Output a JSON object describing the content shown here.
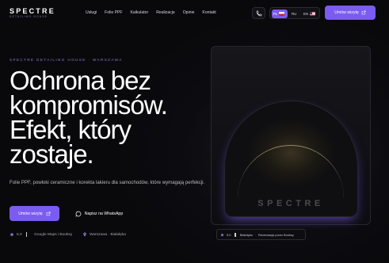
{
  "header": {
    "logo": "SPECTRE",
    "logo_sub": "DETAILING HOUSE",
    "nav": [
      "Usługi",
      "Folie PPF",
      "Kalkulator",
      "Realizacje",
      "Opinie",
      "Kontakt"
    ],
    "languages": [
      {
        "code": "PL",
        "active": true
      },
      {
        "code": "RU",
        "active": false
      },
      {
        "code": "EN",
        "active": false
      }
    ],
    "cta": "Umów wizytę"
  },
  "hero": {
    "eyebrow": "SPECTRE DETAILING HOUSE · WARSZAWA",
    "headline": [
      "Ochrona bez",
      "kompromisów.",
      "Efekt, który",
      "zostaje."
    ],
    "description": "Folie PPF, powłoki ceramiczne i korekta lakieru dla samochodów, które wymagają perfekcji.",
    "primary_button": "Umów wizytę",
    "whatsapp_button": "Napisz na WhatsApp",
    "rating": "5.0",
    "rating_source": "Google Maps i Booksy",
    "location": "Warszawa · Białołęka"
  },
  "card": {
    "logo": "SPECTRE",
    "status_rating": "5.0",
    "status_text1": "Białołęka",
    "status_text2": "Rezerwacja przez Booksy"
  },
  "colors": {
    "accent": "#7b5cf0",
    "background": "#09090c",
    "eyebrow": "#8f7ad6"
  },
  "icons": [
    "phone-icon",
    "external-link-icon",
    "whatsapp-icon",
    "star-icon",
    "location-pin-icon",
    "flag-pl-icon",
    "flag-en-icon"
  ]
}
